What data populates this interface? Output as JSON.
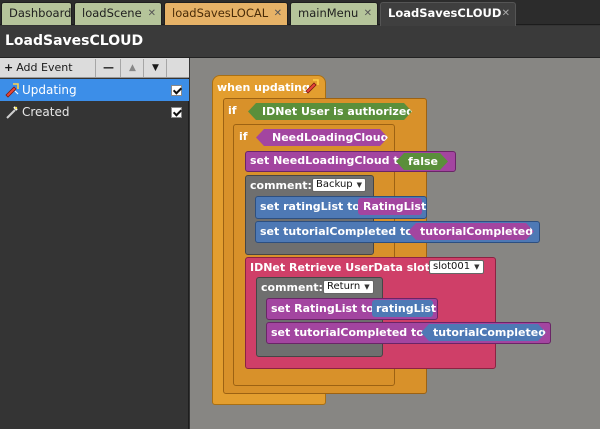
{
  "tabs": [
    {
      "label": "Dashboard"
    },
    {
      "label": "loadScene"
    },
    {
      "label": "loadSavesLOCAL"
    },
    {
      "label": "mainMenu"
    },
    {
      "label": "LoadSavesCLOUD"
    }
  ],
  "tab_close_glyph": "✕",
  "page_title": "LoadSavesCLOUD",
  "sidebar": {
    "add_event_label": "Add Event",
    "remove_label": "—",
    "up_label": "▲",
    "down_label": "▼",
    "events": [
      {
        "label": "Updating",
        "icon": "updating-icon",
        "enabled": true
      },
      {
        "label": "Created",
        "icon": "created-icon",
        "enabled": true
      }
    ]
  },
  "workspace": {
    "event_label": "when updating",
    "if1_label": "if",
    "authorized_label": "IDNet User is authorized",
    "if2_label": "if",
    "need_loading_cloud_label": "NeedLoadingCloud",
    "set_need_loading_label": "set NeedLoadingCloud to",
    "false_label": "false",
    "comment1_label": "comment:",
    "comment1_value": "Backup",
    "set_rating_label": "set ratingList to",
    "rating_list_var": "RatingList",
    "set_tutorial_label": "set tutorialCompleted to",
    "tutorial_completed_var": "tutorialCompleted",
    "retrieve_label": "IDNet Retrieve UserData slot:",
    "slot_value": "slot001",
    "comment2_label": "comment:",
    "comment2_value": "Return",
    "set_rating2_label": "set RatingList to",
    "rating_list2_var": "ratingList",
    "set_tutorial2_label": "set tutorialCompleted to",
    "tutorial_completed2_var": "tutorialCompleted"
  },
  "colors": {
    "event_orange": "#e39e2f",
    "if_orange": "#d8912a",
    "variable_purple": "#a345a0",
    "boolean_green": "#5a8f3b",
    "comment_gray": "#6f6f6f",
    "list_blue": "#4e79b5",
    "idnet_pink": "#cf3f68",
    "workspace_bg": "#878683",
    "selected_blue": "#3c8ee8"
  }
}
